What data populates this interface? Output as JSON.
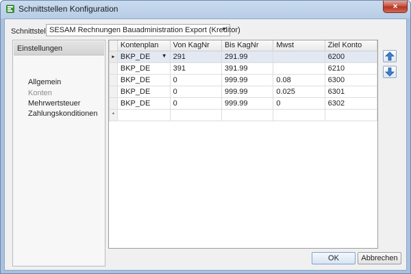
{
  "window": {
    "title": "Schnittstellen Konfiguration",
    "close_label": "×"
  },
  "schnittstelle": {
    "label": "Schnittstelle",
    "value": "SESAM Rechnungen Bauadministration Export (Kreditor)"
  },
  "left_panel": {
    "header": "Einstellungen",
    "items": [
      "Allgemein",
      "Konten",
      "Mehrwertsteuer",
      "Zahlungskonditionen"
    ],
    "selected": "Konten"
  },
  "grid": {
    "columns": [
      "Kontenplan",
      "Von KagNr",
      "Bis KagNr",
      "Mwst",
      "Ziel Konto"
    ],
    "rows": [
      [
        "BKP_DE",
        "291",
        "291.99",
        "",
        "6200"
      ],
      [
        "BKP_DE",
        "391",
        "391.99",
        "",
        "6210"
      ],
      [
        "BKP_DE",
        "0",
        "999.99",
        "0.08",
        "6300"
      ],
      [
        "BKP_DE",
        "0",
        "999.99",
        "0.025",
        "6301"
      ],
      [
        "BKP_DE",
        "0",
        "999.99",
        "0",
        "6302"
      ]
    ],
    "new_row_marker": "*",
    "focused_row_marker": "▸"
  },
  "buttons": {
    "ok": "OK",
    "cancel": "Abbrechen"
  },
  "colors": {
    "titlebar": "#b7cde6",
    "close": "#c7493a",
    "move_arrow": "#3e7fd0",
    "selection": "#e2e9f3"
  }
}
